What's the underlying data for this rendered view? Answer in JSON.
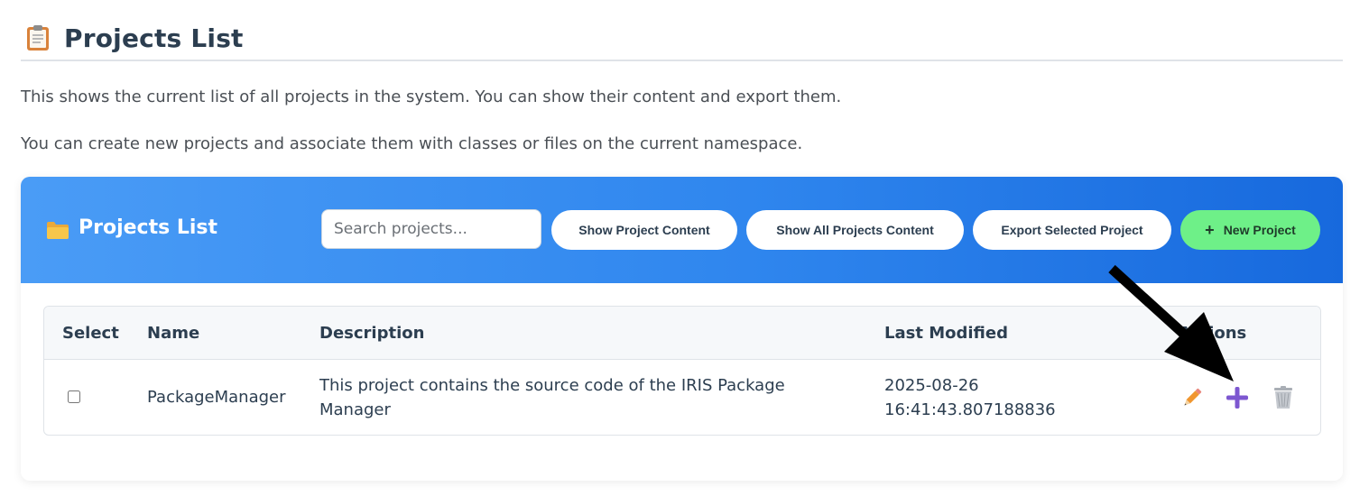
{
  "page": {
    "title": "Projects List",
    "title_icon": "clipboard-icon",
    "intro_line1": "This shows the current list of all projects in the system. You can show their content and export them.",
    "intro_line2": "You can create new projects and associate them with classes or files on the current namespace."
  },
  "card": {
    "title": "Projects List",
    "title_icon": "folder-icon",
    "header_gradient": [
      "#4a9cf6",
      "#1769dd"
    ],
    "search_placeholder": "Search projects...",
    "buttons": {
      "show_content": "Show Project Content",
      "show_all": "Show All Projects Content",
      "export": "Export Selected Project",
      "new_project": "New Project",
      "new_project_icon": "plus-icon"
    },
    "new_button_color": "#6ef088"
  },
  "table": {
    "headers": {
      "select": "Select",
      "name": "Name",
      "description": "Description",
      "last_modified": "Last Modified",
      "actions": "Actions"
    },
    "rows": [
      {
        "selected": false,
        "name": "PackageManager",
        "description_line1": "This project contains the source code of the IRIS Package",
        "description_line2": "Manager",
        "modified_date": "2025-08-26",
        "modified_time": "16:41:43.807188836",
        "actions": [
          "pencil-icon",
          "plus-icon",
          "trash-icon"
        ]
      }
    ]
  },
  "annotation": {
    "type": "arrow",
    "color": "#000000",
    "points_to": "add-action"
  }
}
